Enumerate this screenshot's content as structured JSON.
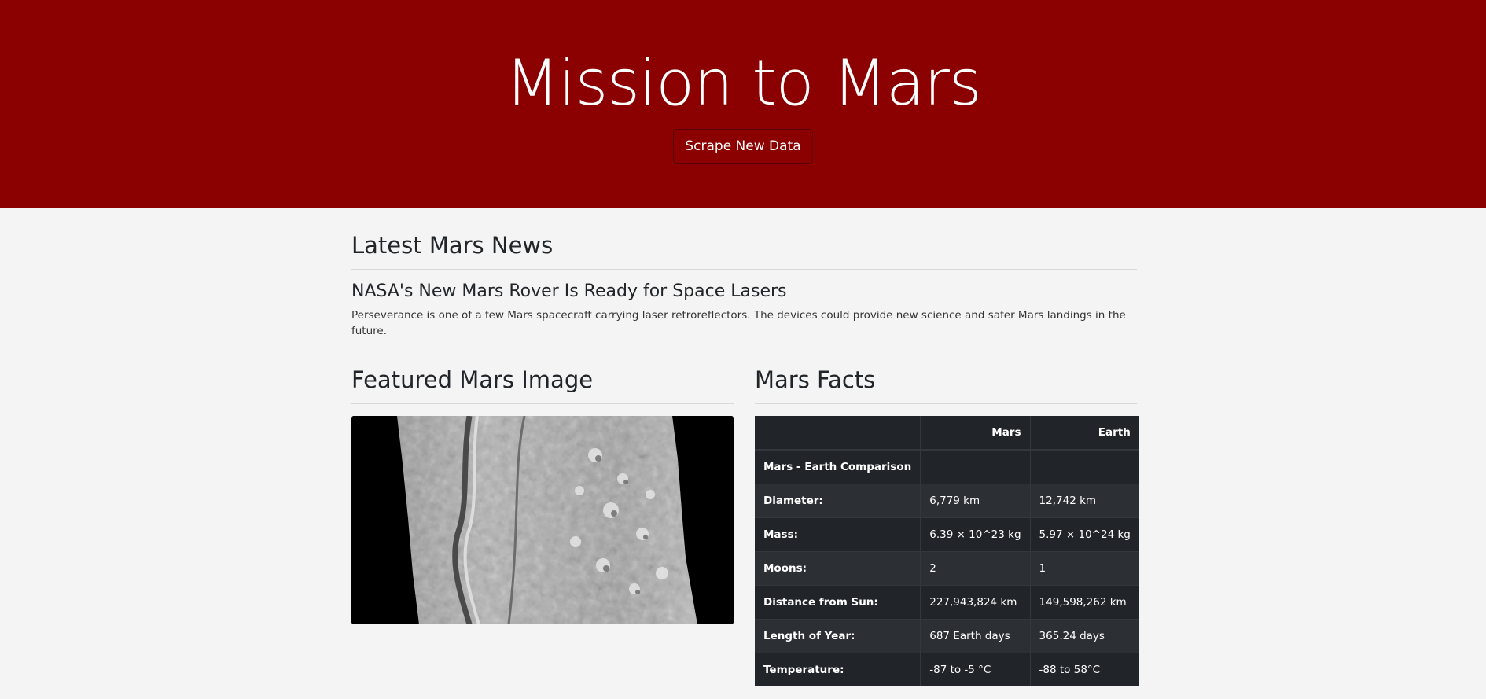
{
  "hero": {
    "title": "Mission to Mars",
    "scrape_button": "Scrape New Data"
  },
  "news": {
    "heading": "Latest Mars News",
    "title": "NASA's New Mars Rover Is Ready for Space Lasers",
    "teaser": "Perseverance is one of a few Mars spacecraft carrying laser retroreflectors. The devices could provide new science and safer Mars landings in the future."
  },
  "featured_image": {
    "heading": "Featured Mars Image",
    "alt": "grayscale orbital image of Mars surface"
  },
  "facts": {
    "heading": "Mars Facts",
    "columns": [
      "",
      "Mars",
      "Earth"
    ],
    "rows": [
      [
        "Mars - Earth Comparison",
        "",
        ""
      ],
      [
        "Diameter:",
        "6,779 km",
        "12,742 km"
      ],
      [
        "Mass:",
        "6.39 × 10^23 kg",
        "5.97 × 10^24 kg"
      ],
      [
        "Moons:",
        "2",
        "1"
      ],
      [
        "Distance from Sun:",
        "227,943,824 km",
        "149,598,262 km"
      ],
      [
        "Length of Year:",
        "687 Earth days",
        "365.24 days"
      ],
      [
        "Temperature:",
        "-87 to -5 °C",
        "-88 to 58°C"
      ]
    ]
  },
  "colors": {
    "hero_bg": "#8b0000",
    "page_bg": "#f4f4f4",
    "table_bg": "#212529"
  }
}
